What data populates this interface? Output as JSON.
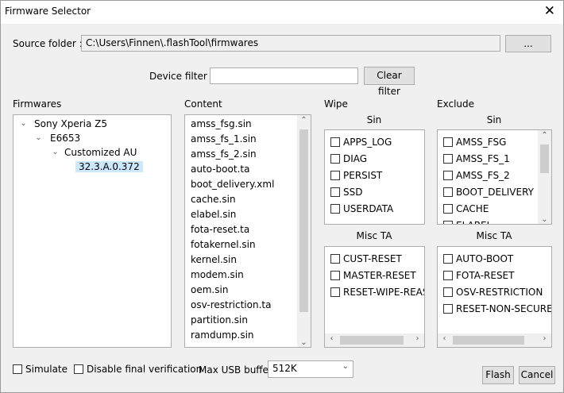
{
  "window": {
    "title": "Firmware Selector",
    "source_folder_label": "Source folder :",
    "source_folder_value": "C:\\Users\\Finnen\\.flashTool\\firmwares",
    "browse_label": "...",
    "device_filter_label": "Device filter :",
    "device_filter_value": "",
    "clear_filter_label": "Clear filter"
  },
  "firmwares": {
    "title": "Firmwares",
    "tree": [
      "Sony Xperia Z5",
      "E6653",
      "Customized AU",
      "32.3.A.0.372"
    ]
  },
  "content": {
    "title": "Content",
    "items": [
      "amss_fsg.sin",
      "amss_fs_1.sin",
      "amss_fs_2.sin",
      "auto-boot.ta",
      "boot_delivery.xml",
      "cache.sin",
      "elabel.sin",
      "fota-reset.ta",
      "fotakernel.sin",
      "kernel.sin",
      "modem.sin",
      "oem.sin",
      "osv-restriction.ta",
      "partition.sin",
      "ramdump.sin"
    ]
  },
  "wipe": {
    "title": "Wipe",
    "sin_title": "Sin",
    "sin_items": [
      "APPS_LOG",
      "DIAG",
      "PERSIST",
      "SSD",
      "USERDATA"
    ],
    "ta_title": "Misc TA",
    "ta_items": [
      "CUST-RESET",
      "MASTER-RESET",
      "RESET-WIPE-REASON"
    ]
  },
  "exclude": {
    "title": "Exclude",
    "sin_title": "Sin",
    "sin_items": [
      "AMSS_FSG",
      "AMSS_FS_1",
      "AMSS_FS_2",
      "BOOT_DELIVERY",
      "CACHE",
      "ELABEL"
    ],
    "ta_title": "Misc TA",
    "ta_items": [
      "AUTO-BOOT",
      "FOTA-RESET",
      "OSV-RESTRICTION",
      "RESET-NON-SECURE-ADB"
    ]
  },
  "footer": {
    "simulate_label": "Simulate",
    "disable_verification_label": "Disable final verification",
    "max_usb_label": "Max USB buffer",
    "max_usb_value": "512K",
    "flash_label": "Flash",
    "cancel_label": "Cancel"
  }
}
